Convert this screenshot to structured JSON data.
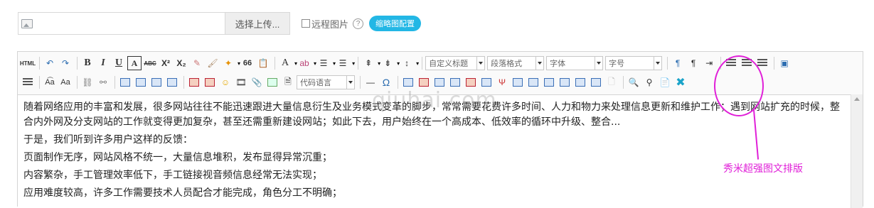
{
  "upload": {
    "button_label": "选择上传...",
    "remote_label": "远程图片",
    "help": "?",
    "thumb_label": "缩略图配置"
  },
  "toolbar": {
    "html_label": "HTML",
    "custom_title": "自定义标题",
    "paragraph_format": "段落格式",
    "font": "字体",
    "font_size": "字号",
    "code_language": "代码语言",
    "letter_A": "A",
    "bold": "B",
    "italic": "I",
    "underline": "U",
    "strike": "ABC",
    "superscript": "X²",
    "subscript": "X₂",
    "omega": "Ω",
    "quote": "66"
  },
  "content": {
    "paragraphs": [
      "随着网络应用的丰富和发展，很多网站往往不能迅速跟进大量信息衍生及业务模式变革的脚步，常常需要花费许多时间、人力和物力来处理信息更新和维护工作；遇到网站扩充的时候，整合内外网及分支网站的工作就变得更加复杂，甚至还需重新建设网站；如此下去，用户始终在一个高成本、低效率的循环中升级、整合...",
      "于是，我们听到许多用户这样的反馈：",
      "页面制作无序，网站风格不统一，大量信息堆积，发布显得异常沉重；",
      "内容繁杂，手工管理效率低下，手工链接视音频信息经常无法实现；",
      "应用难度较高，许多工作需要技术人员配合才能完成，角色分工不明确；"
    ]
  },
  "watermark": "qiuhai.com",
  "annotation": {
    "label": "秀米超强图文排版",
    "color": "#e020d8"
  },
  "colors": {
    "accent": "#23b7e5",
    "annotation": "#e020d8"
  }
}
